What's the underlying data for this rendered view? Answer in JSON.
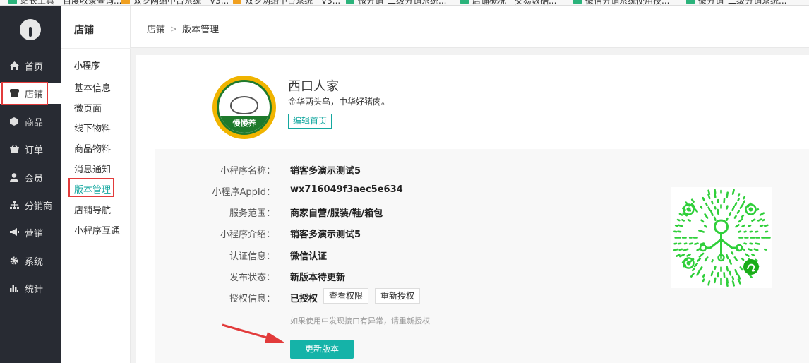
{
  "bookmarks": [
    {
      "label": "站长工具 - 百度收录查询...",
      "icon": "bookmark-icon"
    },
    {
      "label": "双乡网络中台系统 - V3...",
      "icon": "bookmark-icon"
    },
    {
      "label": "双乡网络中台系统 - V3...",
      "icon": "bookmark-icon"
    },
    {
      "label": "微分销_二级分销系统...",
      "icon": "bookmark-icon"
    },
    {
      "label": "店铺概况 - 交易数据...",
      "icon": "bookmark-icon"
    },
    {
      "label": "微信分销系统使用技...",
      "icon": "bookmark-icon"
    },
    {
      "label": "微分销_二级分销系统...",
      "icon": "bookmark-icon"
    }
  ],
  "leftnav": {
    "items": [
      {
        "label": "首页",
        "icon": "home-icon"
      },
      {
        "label": "店铺",
        "icon": "store-icon",
        "active": true
      },
      {
        "label": "商品",
        "icon": "cube-icon"
      },
      {
        "label": "订单",
        "icon": "basket-icon"
      },
      {
        "label": "会员",
        "icon": "user-icon"
      },
      {
        "label": "分销商",
        "icon": "sitemap-icon"
      },
      {
        "label": "营销",
        "icon": "megaphone-icon"
      },
      {
        "label": "系统",
        "icon": "gear-icon"
      },
      {
        "label": "统计",
        "icon": "bar-chart-icon"
      }
    ]
  },
  "subnav": {
    "title": "店铺",
    "group": "小程序",
    "items": [
      "基本信息",
      "微页面",
      "线下物料",
      "商品物料",
      "消息通知",
      "版本管理",
      "店铺导航",
      "小程序互通"
    ],
    "active_index": 5
  },
  "breadcrumb": {
    "root": "店铺",
    "separator": ">",
    "current": "版本管理"
  },
  "shop": {
    "name": "西口人家",
    "slogan": "金华两头乌，中华好猪肉。",
    "logo_text": "慢慢养",
    "edit_label": "编辑首页"
  },
  "info": {
    "rows": [
      {
        "label": "小程序名称：",
        "value": "销客多演示测试5"
      },
      {
        "label": "小程序AppId：",
        "value": "wx716049f3aec5e634"
      },
      {
        "label": "服务范围：",
        "value": "商家自营/服装/鞋/箱包"
      },
      {
        "label": "小程序介绍：",
        "value": "销客多演示测试5"
      },
      {
        "label": "认证信息：",
        "value": "微信认证"
      },
      {
        "label": "发布状态：",
        "value": "新版本待更新"
      },
      {
        "label": "授权信息：",
        "value": "已授权"
      }
    ],
    "view_permission_label": "查看权限",
    "reauthorize_label": "重新授权",
    "hint": "如果使用中发现接口有异常，请重新授权",
    "update_label": "更新版本"
  },
  "colors": {
    "accent": "#15a8a0",
    "nav_bg": "#282b33",
    "highlight": "#e23b3b",
    "qr_green": "#2fcf3a"
  }
}
